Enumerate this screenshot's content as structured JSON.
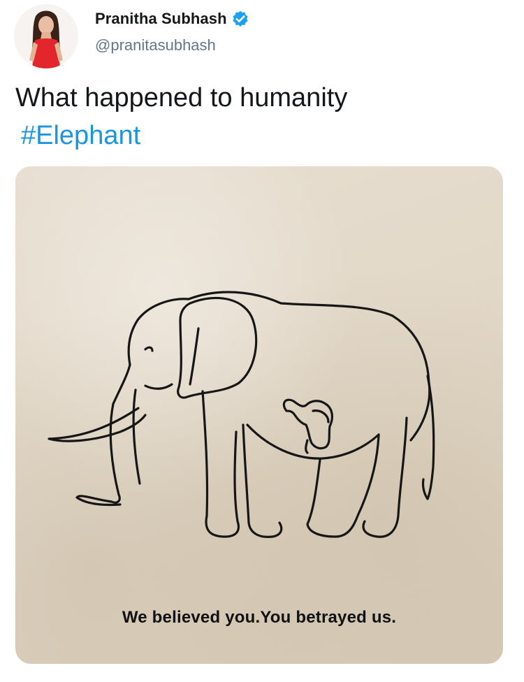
{
  "user": {
    "display_name": "Pranitha Subhash",
    "handle": "@pranitasubhash",
    "verified_icon": "verified-badge-icon"
  },
  "tweet": {
    "text": "What happened to humanity",
    "hashtag": "#Elephant",
    "hashtag_color": "#1b95e0"
  },
  "media": {
    "caption": "We believed you.You betrayed us.",
    "illustration": "elephant-line-art-with-baby-elephant-in-belly"
  }
}
